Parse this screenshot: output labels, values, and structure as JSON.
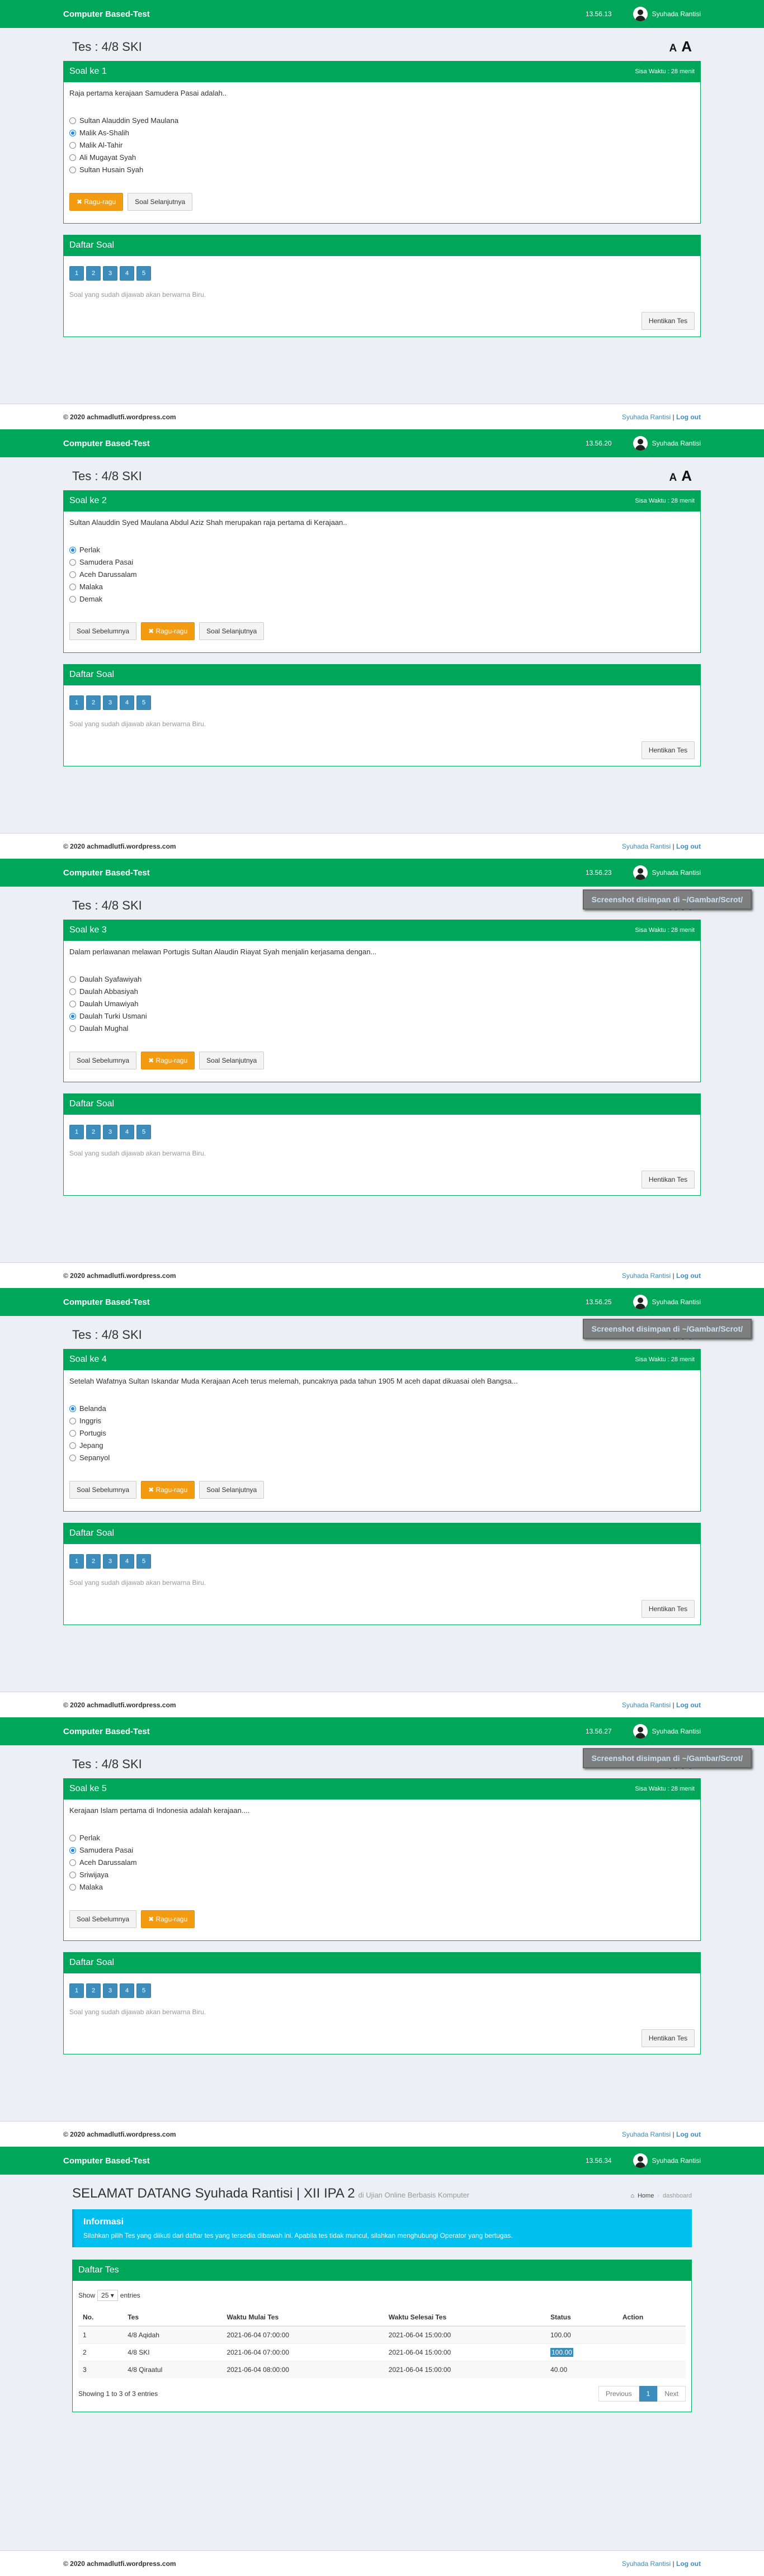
{
  "app": {
    "brand": "Computer Based-Test",
    "user": "Syuhada Rantisi"
  },
  "footer": {
    "copyright": "© 2020 achmadlutfi.wordpress.com",
    "user": "Syuhada Rantisi",
    "sep": " | ",
    "logout": "Log out"
  },
  "test_title": "Tes : 4/8 SKI",
  "font_small": "A",
  "font_big": "A",
  "timer": "Sisa Waktu : 28 menit",
  "buttons": {
    "prev": "Soal Sebelumnya",
    "doubt": "✖ Ragu-ragu",
    "next": "Soal Selanjutnya",
    "stop": "Hentikan Tes"
  },
  "list_title": "Daftar Soal",
  "list_numbers": [
    "1",
    "2",
    "3",
    "4",
    "5"
  ],
  "list_note": "Soal yang sudah dijawab akan berwarna Biru.",
  "toast": "Screenshot disimpan di ~/Gambar/Scrot/",
  "screens": [
    {
      "clock": "13.56.13",
      "label": "Soal ke 1",
      "question": "Raja pertama kerajaan Samudera Pasai adalah..",
      "options": [
        "Sultan Alauddin Syed Maulana",
        "Malik As-Shalih",
        "Malik Al-Tahir",
        "Ali Mugayat Syah",
        "Sultan Husain Syah"
      ],
      "selected": 1
    },
    {
      "clock": "13.56.20",
      "label": "Soal ke 2",
      "question": "Sultan Alauddin Syed Maulana Abdul Aziz Shah merupakan raja pertama di Kerajaan..",
      "options": [
        "Perlak",
        "Samudera Pasai",
        "Aceh Darussalam",
        "Malaka",
        "Demak"
      ],
      "selected": 0
    },
    {
      "clock": "13.56.23",
      "label": "Soal ke 3",
      "question": "Dalam perlawanan melawan Portugis Sultan Alaudin Riayat Syah menjalin kerjasama dengan...",
      "options": [
        "Daulah Syafawiyah",
        "Daulah Abbasiyah",
        "Daulah Umawiyah",
        "Daulah Turki Usmani",
        "Daulah Mughal"
      ],
      "selected": 3
    },
    {
      "clock": "13.56.25",
      "label": "Soal ke 4",
      "question": "Setelah Wafatnya Sultan Iskandar Muda Kerajaan Aceh terus melemah, puncaknya pada tahun 1905 M aceh dapat dikuasai oleh Bangsa...",
      "options": [
        "Belanda",
        "Inggris",
        "Portugis",
        "Jepang",
        "Sepanyol"
      ],
      "selected": 0
    },
    {
      "clock": "13.56.27",
      "label": "Soal ke 5",
      "question": "Kerajaan Islam pertama di Indonesia adalah kerajaan....",
      "options": [
        "Perlak",
        "Samudera Pasai",
        "Aceh Darussalam",
        "Sriwijaya",
        "Malaka"
      ],
      "selected": 1
    }
  ],
  "dashboard": {
    "clock": "13.56.34",
    "welcome": "SELAMAT DATANG Syuhada Rantisi | XII IPA 2",
    "subtitle": "di Ujian Online Berbasis Komputer",
    "bc_home": "Home",
    "bc_current": "dashboard",
    "info_title": "Informasi",
    "info_text": "Silahkan pilih Tes yang diikuti dari daftar tes yang tersedia dibawah ini. Apabila tes tidak muncul, silahkan menghubungi Operator yang bertugas.",
    "table_title": "Daftar Tes",
    "show": "Show",
    "entries_value": "25",
    "entries": "entries",
    "columns": [
      "No.",
      "Tes",
      "Waktu Mulai Tes",
      "Waktu Selesai Tes",
      "Status",
      "Action"
    ],
    "rows": [
      [
        "1",
        "4/8 Aqidah",
        "2021-06-04 07:00:00",
        "2021-06-04 15:00:00",
        "100.00",
        ""
      ],
      [
        "2",
        "4/8 SKI",
        "2021-06-04 07:00:00",
        "2021-06-04 15:00:00",
        "100.00",
        ""
      ],
      [
        "3",
        "4/8 Qiraatul",
        "2021-06-04 08:00:00",
        "2021-06-04 15:00:00",
        "40.00",
        ""
      ]
    ],
    "showing": "Showing 1 to 3 of 3 entries",
    "prev": "Previous",
    "page": "1",
    "next": "Next"
  }
}
